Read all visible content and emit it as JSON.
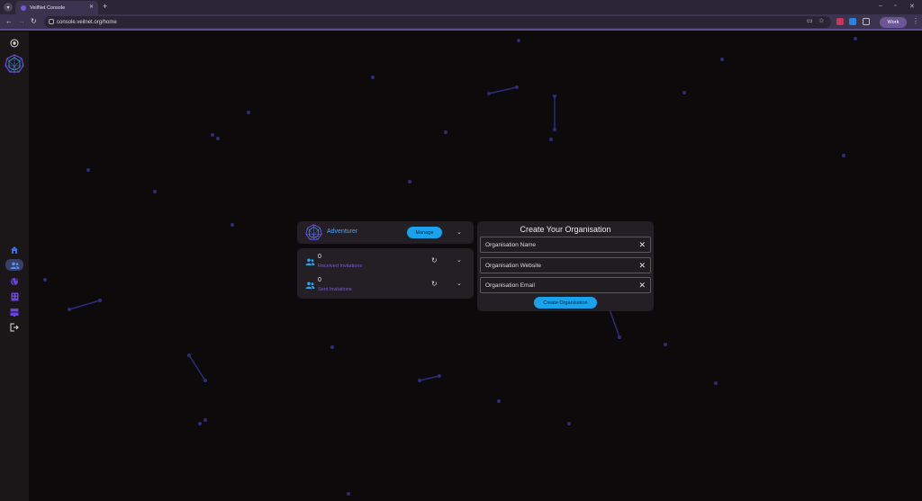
{
  "browser": {
    "tab_title": "VeilNet Console",
    "url": "console.veilnet.org/home",
    "profile_label": "Work"
  },
  "user_card": {
    "name": "Adventurer",
    "manage_label": "Manage"
  },
  "invitations": [
    {
      "count": "0",
      "label": "Received Invitations"
    },
    {
      "count": "0",
      "label": "Sent Invitations"
    }
  ],
  "org_form": {
    "title": "Create Your Organisation",
    "fields": [
      {
        "label": "Organisation Name"
      },
      {
        "label": "Organisation Website"
      },
      {
        "label": "Organisation Email"
      }
    ],
    "submit_label": "Create Organisation"
  },
  "colors": {
    "accent_blue": "#1aa3ec",
    "accent_purple": "#7b5ad6",
    "background": "#0d0a0c",
    "card": "#241f24"
  },
  "sidebar_icons": [
    "add-circle-icon",
    "logo-icon",
    "home-icon",
    "people-icon",
    "globe-icon",
    "building-icon",
    "servers-icon",
    "logout-icon"
  ]
}
